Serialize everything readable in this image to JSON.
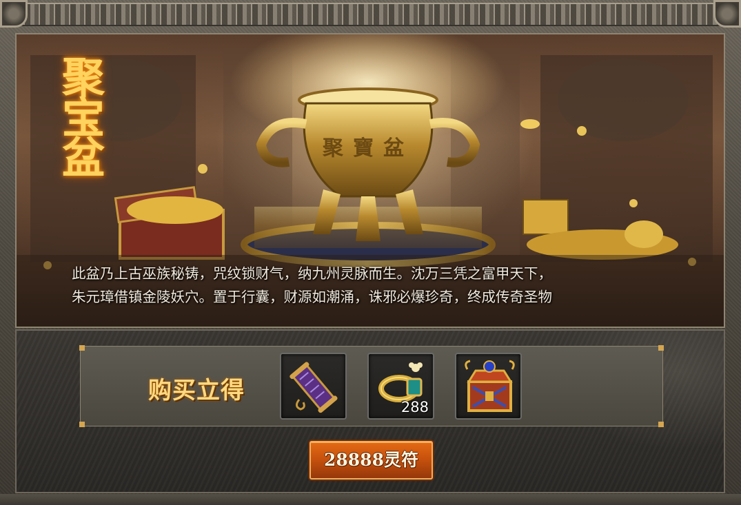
{
  "banner": {
    "title": "聚宝盆",
    "cauldron_text": "聚寶盆",
    "description_lines": [
      "此盆乃上古巫族秘铸，咒纹锁财气，纳九州灵脉而生。沈万三凭之富甲天下，",
      "朱元璋借镇金陵妖穴。置于行囊，财源如潮涌，诛邪必爆珍奇，终成传奇圣物"
    ]
  },
  "rewards": {
    "label": "购买立得",
    "items": [
      {
        "icon": "scroll-icon",
        "count": ""
      },
      {
        "icon": "golden-bracelet-icon",
        "count": "288"
      },
      {
        "icon": "treasure-chest-icon",
        "count": ""
      }
    ]
  },
  "purchase": {
    "price_label": "28888灵符"
  },
  "colors": {
    "title_gold": "#ffd35e",
    "button_orange": "#c8520d",
    "panel_bg": "#2f2c29"
  }
}
